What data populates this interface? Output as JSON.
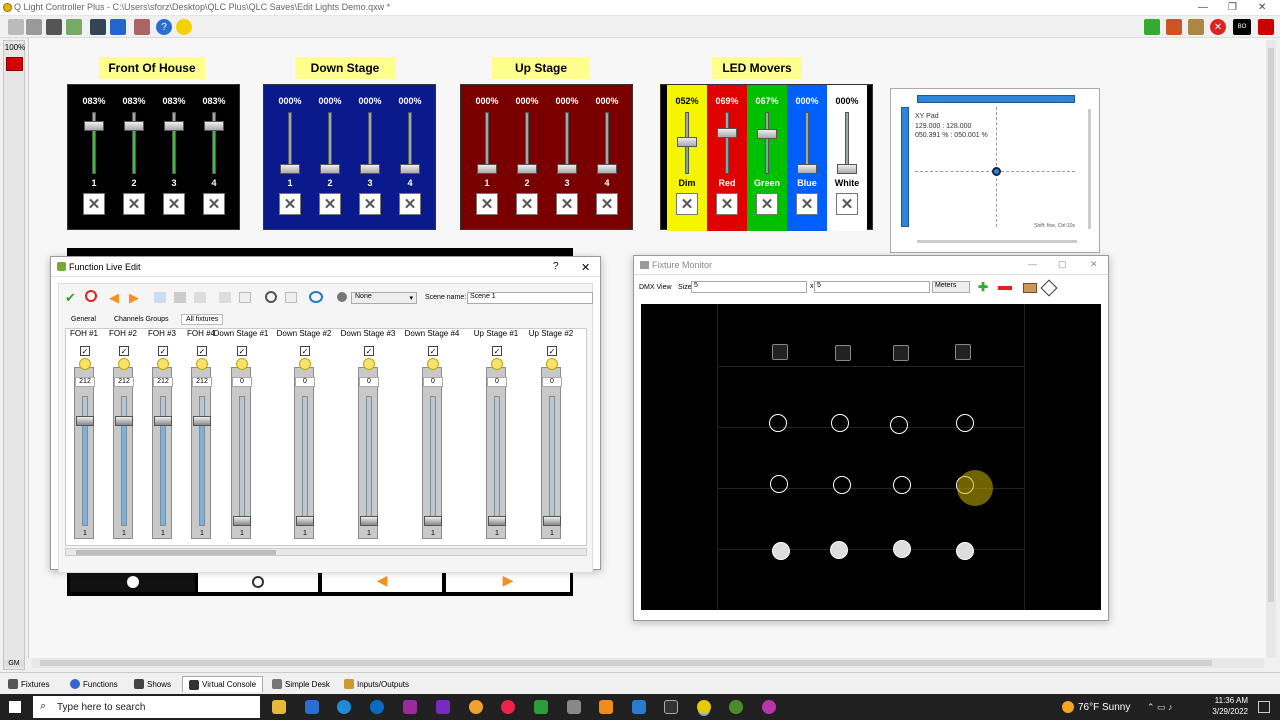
{
  "window": {
    "title": "Q Light Controller Plus - C:\\Users\\sforz\\Desktop\\QLC Plus\\QLC Saves\\Edit Lights Demo.qxw *"
  },
  "gm": {
    "percent": "100%",
    "label": "GM"
  },
  "frames": [
    {
      "title": "Front Of House",
      "bg": "#000000",
      "channels": [
        {
          "value": "083%",
          "label": "1",
          "level": 0.83
        },
        {
          "value": "083%",
          "label": "2",
          "level": 0.83
        },
        {
          "value": "083%",
          "label": "3",
          "level": 0.83
        },
        {
          "value": "083%",
          "label": "4",
          "level": 0.83
        }
      ]
    },
    {
      "title": "Down Stage",
      "bg": "#0a1a8c",
      "channels": [
        {
          "value": "000%",
          "label": "1",
          "level": 0
        },
        {
          "value": "000%",
          "label": "2",
          "level": 0
        },
        {
          "value": "000%",
          "label": "3",
          "level": 0
        },
        {
          "value": "000%",
          "label": "4",
          "level": 0
        }
      ]
    },
    {
      "title": "Up Stage",
      "bg": "#7a0000",
      "channels": [
        {
          "value": "000%",
          "label": "1",
          "level": 0
        },
        {
          "value": "000%",
          "label": "2",
          "level": 0
        },
        {
          "value": "000%",
          "label": "3",
          "level": 0
        },
        {
          "value": "000%",
          "label": "4",
          "level": 0
        }
      ]
    },
    {
      "title": "LED Movers",
      "bg": "#000000",
      "channels": [
        {
          "value": "052%",
          "label": "Dim",
          "level": 0.52,
          "bg": "#f5f500",
          "fg": "#000"
        },
        {
          "value": "069%",
          "label": "Red",
          "level": 0.69,
          "bg": "#e00000",
          "fg": "#fff"
        },
        {
          "value": "067%",
          "label": "Green",
          "level": 0.67,
          "bg": "#00c000",
          "fg": "#fff"
        },
        {
          "value": "000%",
          "label": "Blue",
          "level": 0,
          "bg": "#0060ff",
          "fg": "#fff"
        },
        {
          "value": "000%",
          "label": "White",
          "level": 0,
          "bg": "#ffffff",
          "fg": "#000"
        }
      ]
    }
  ],
  "xypad": {
    "title": "XY Pad",
    "dmx": "129.000 : 128.000",
    "pct": "050.391 % : 050.001 %",
    "hint": "Shift: fine, Ctrl:10x"
  },
  "fle": {
    "title": "Function Live Edit",
    "help": "?",
    "close": "✕",
    "mode": "None",
    "scene_label": "Scene name:",
    "scene_name": "Scene 1",
    "tabs": [
      "General",
      "Channels Groups",
      "All fixtures"
    ],
    "fixtures": [
      {
        "name": "FOH #1",
        "value": "212",
        "num": "1",
        "level": 0.83
      },
      {
        "name": "FOH #2",
        "value": "212",
        "num": "1",
        "level": 0.83
      },
      {
        "name": "FOH #3",
        "value": "212",
        "num": "1",
        "level": 0.83
      },
      {
        "name": "FOH #4",
        "value": "212",
        "num": "1",
        "level": 0.83
      },
      {
        "name": "Down Stage #1",
        "value": "0",
        "num": "1",
        "level": 0
      },
      {
        "name": "Down Stage #2",
        "value": "0",
        "num": "1",
        "level": 0
      },
      {
        "name": "Down Stage #3",
        "value": "0",
        "num": "1",
        "level": 0
      },
      {
        "name": "Down Stage #4",
        "value": "0",
        "num": "1",
        "level": 0
      },
      {
        "name": "Up Stage #1",
        "value": "0",
        "num": "1",
        "level": 0
      },
      {
        "name": "Up Stage #2",
        "value": "0",
        "num": "1",
        "level": 0
      }
    ]
  },
  "fm": {
    "title": "Fixture Monitor",
    "dmx_view": "DMX View",
    "size_label": "Size",
    "size_w": "5",
    "size_x": "x",
    "size_h": "5",
    "units": "Meters"
  },
  "tabs": [
    "Fixtures",
    "Functions",
    "Shows",
    "Virtual Console",
    "Simple Desk",
    "Inputs/Outputs"
  ],
  "taskbar": {
    "search": "Type here to search",
    "weather": "76°F  Sunny",
    "time": "11:36 AM",
    "date": "3/29/2022"
  }
}
